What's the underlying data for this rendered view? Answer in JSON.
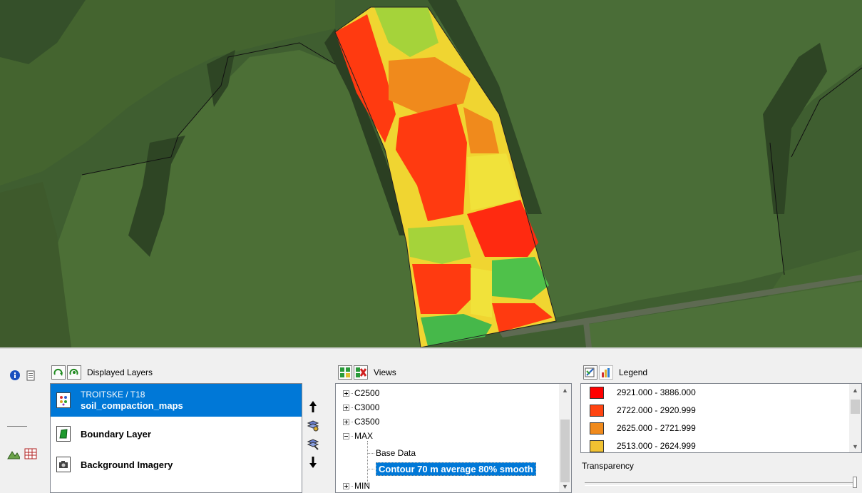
{
  "colors": {
    "selection": "#0078d7",
    "c1": "#ff0000",
    "c2": "#ff4411",
    "c3": "#f08a1c",
    "c4": "#f1c232"
  },
  "layers": {
    "title": "Displayed Layers",
    "items": [
      {
        "line1": "TROITSKE / T18",
        "line2": "soil_compaction_maps",
        "icon": "grid-map-icon",
        "selected": true
      },
      {
        "name": "Boundary Layer",
        "icon": "boundary-icon"
      },
      {
        "name": "Background Imagery",
        "icon": "camera-icon"
      }
    ]
  },
  "views": {
    "title": "Views",
    "nodes": [
      {
        "label": "C2500",
        "expanded": false,
        "level": 0
      },
      {
        "label": "C3000",
        "expanded": false,
        "level": 0
      },
      {
        "label": "C3500",
        "expanded": false,
        "level": 0
      },
      {
        "label": "MAX",
        "expanded": true,
        "level": 0
      },
      {
        "label": "Base Data",
        "level": 1
      },
      {
        "label": "Contour 70 m average 80% smooth",
        "level": 1,
        "selected": true
      },
      {
        "label": "MIN",
        "expanded": false,
        "level": 0
      }
    ]
  },
  "legend": {
    "title": "Legend",
    "items": [
      {
        "label": "2921.000 - 3886.000",
        "color": "#ff0000"
      },
      {
        "label": "2722.000 - 2920.999",
        "color": "#ff4411"
      },
      {
        "label": "2625.000 - 2721.999",
        "color": "#f08a1c"
      },
      {
        "label": "2513.000 - 2624.999",
        "color": "#f1c232"
      }
    ],
    "transparency_label": "Transparency"
  }
}
